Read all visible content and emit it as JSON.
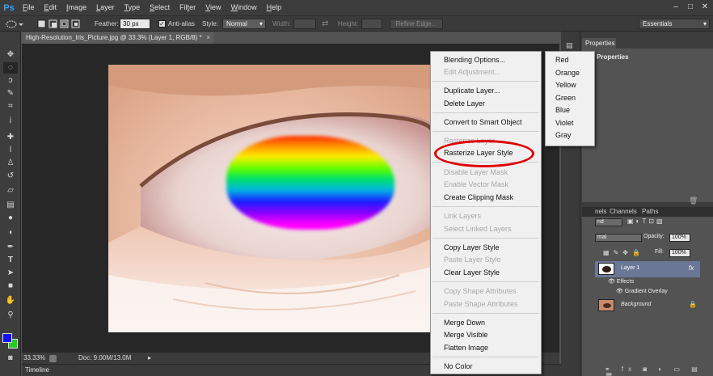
{
  "menubar": {
    "logo": "Ps",
    "items": [
      {
        "pre": "",
        "u": "F",
        "post": "ile"
      },
      {
        "pre": "",
        "u": "E",
        "post": "dit"
      },
      {
        "pre": "",
        "u": "I",
        "post": "mage"
      },
      {
        "pre": "",
        "u": "L",
        "post": "ayer"
      },
      {
        "pre": "",
        "u": "T",
        "post": "ype"
      },
      {
        "pre": "",
        "u": "S",
        "post": "elect"
      },
      {
        "pre": "Fil",
        "u": "t",
        "post": "er"
      },
      {
        "pre": "",
        "u": "V",
        "post": "iew"
      },
      {
        "pre": "",
        "u": "W",
        "post": "indow"
      },
      {
        "pre": "",
        "u": "H",
        "post": "elp"
      }
    ],
    "window_buttons": [
      "–",
      "□",
      "✕"
    ]
  },
  "options": {
    "feather_label": "Feather:",
    "feather_value": "30 px",
    "antialias_label": "Anti-alias",
    "antialias_checked": "✓",
    "style_label": "Style:",
    "style_value": "Normal",
    "width_label": "Width:",
    "height_label": "Height:",
    "swap_icon": "⇄",
    "refine_edge": "Refine Edge...",
    "workspace": "Essentials"
  },
  "document": {
    "tab_title": "High-Resolution_Iris_Picture.jpg @ 33.3% (Layer 1, RGB/8) *",
    "close": "×"
  },
  "status": {
    "zoom": "33.33%",
    "doc_size": "Doc: 9.00M/13.0M",
    "arrow": "▸"
  },
  "timeline": {
    "label": "Timeline"
  },
  "properties": {
    "tab": "Properties",
    "header": "Properties"
  },
  "layers": {
    "tabs": [
      "nels",
      "Channels",
      "Paths"
    ],
    "kind": "nd",
    "blend_mode": "mal",
    "opacity_label": "Opacity:",
    "opacity_value": "100%",
    "fill_label": "Fill:",
    "fill_value": "100%",
    "layer1_name": "Layer 1",
    "fx": "fx",
    "effects": "Effects",
    "gradient_overlay": "Gradient Overlay",
    "background": "Background"
  },
  "context_menu": {
    "items": [
      {
        "label": "Blending Options...",
        "enabled": true
      },
      {
        "label": "Edit Adjustment...",
        "enabled": false
      },
      {
        "label": "Duplicate Layer...",
        "enabled": true
      },
      {
        "label": "Delete Layer",
        "enabled": true
      },
      {
        "label": "Convert to Smart Object",
        "enabled": true
      },
      {
        "label": "Rasterize Layer",
        "enabled": false
      },
      {
        "label": "Rasterize Layer Style",
        "enabled": true
      },
      {
        "label": "Disable Layer Mask",
        "enabled": false
      },
      {
        "label": "Enable Vector Mask",
        "enabled": false
      },
      {
        "label": "Create Clipping Mask",
        "enabled": true
      },
      {
        "label": "Link Layers",
        "enabled": false
      },
      {
        "label": "Select Linked Layers",
        "enabled": false
      },
      {
        "label": "Copy Layer Style",
        "enabled": true
      },
      {
        "label": "Paste Layer Style",
        "enabled": false
      },
      {
        "label": "Clear Layer Style",
        "enabled": true
      },
      {
        "label": "Copy Shape Attributes",
        "enabled": false
      },
      {
        "label": "Paste Shape Attributes",
        "enabled": false
      },
      {
        "label": "Merge Down",
        "enabled": true
      },
      {
        "label": "Merge Visible",
        "enabled": true
      },
      {
        "label": "Flatten Image",
        "enabled": true
      },
      {
        "label": "No Color",
        "enabled": true
      }
    ]
  },
  "color_menu": {
    "items": [
      "Red",
      "Orange",
      "Yellow",
      "Green",
      "Blue",
      "Violet",
      "Gray"
    ]
  },
  "colors": {
    "foreground": "#1010ff",
    "background": "#22cc22",
    "highlight": "#e00000"
  },
  "tool_icons": [
    "move-icon",
    "marquee-icon",
    "lasso-icon",
    "quick-select-icon",
    "crop-icon",
    "eyedropper-icon",
    "healing-icon",
    "brush-icon",
    "clone-stamp-icon",
    "history-brush-icon",
    "eraser-icon",
    "gradient-icon",
    "blur-icon",
    "dodge-icon",
    "pen-icon",
    "type-icon",
    "path-select-icon",
    "shape-icon",
    "hand-icon",
    "zoom-icon"
  ]
}
